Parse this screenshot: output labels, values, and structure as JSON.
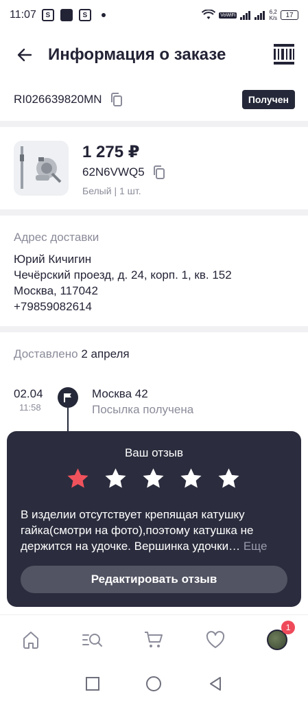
{
  "statusbar": {
    "time": "11:07",
    "icon1": "S",
    "icon3": "S",
    "speed_value": "6,2",
    "speed_unit": "K/s",
    "volte": "VoWiFi",
    "battery": "17"
  },
  "header": {
    "title": "Информация о заказе"
  },
  "order": {
    "tracking_number": "RI026639820MN",
    "status_badge": "Получен"
  },
  "product": {
    "price": "1 275 ₽",
    "article": "62N6VWQ5",
    "variant": "Белый | 1 шт."
  },
  "address": {
    "label": "Адрес доставки",
    "name": "Юрий Кичигин",
    "street": "Чечёрский проезд, д. 24, корп. 1, кв. 152",
    "city": "Москва, 117042",
    "phone": "+79859082614"
  },
  "delivery": {
    "delivered_label": "Доставлено",
    "delivered_date": "2 апреля",
    "timeline": [
      {
        "date": "02.04",
        "time": "11:58",
        "place": "Москва 42",
        "status": "Посылка получена"
      }
    ]
  },
  "review": {
    "title": "Ваш отзыв",
    "rating": 1,
    "max_rating": 5,
    "text": "В изделии отсутствует крепящая катушку гайка(смотри на фото),поэтому катушка не держится на удочке. Вершинка удочки…",
    "more_label": "Еще",
    "edit_button": "Редактировать отзыв"
  },
  "bottom_nav": {
    "items": [
      "home-icon",
      "catalog-search-icon",
      "cart-icon",
      "heart-icon",
      "profile-avatar"
    ],
    "profile_badge": "1"
  },
  "colors": {
    "dark": "#242838",
    "card": "#2b2d3e",
    "star_active": "#f0525c",
    "star_inactive": "#ffffff",
    "muted": "#8a8b99",
    "badge": "#ef4a5a"
  }
}
